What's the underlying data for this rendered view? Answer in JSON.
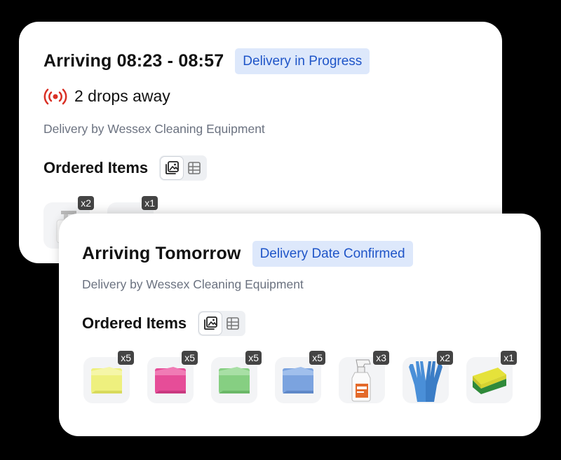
{
  "card1": {
    "title": "Arriving 08:23 - 08:57",
    "status_badge": "Delivery in Progress",
    "drops": "2 drops away",
    "vendor": "Delivery by Wessex Cleaning Equipment",
    "ordered_items_title": "Ordered Items",
    "items": [
      {
        "name": "soap-dispenser-icon",
        "qty": "x2"
      },
      {
        "name": "product-icon",
        "qty": "x1"
      }
    ]
  },
  "card2": {
    "title": "Arriving Tomorrow",
    "status_badge": "Delivery Date Confirmed",
    "vendor": "Delivery by Wessex Cleaning Equipment",
    "ordered_items_title": "Ordered Items",
    "items": [
      {
        "name": "yellow-cloth-icon",
        "qty": "x5",
        "color": "#f0f08a"
      },
      {
        "name": "pink-cloth-icon",
        "qty": "x5",
        "color": "#e8559f"
      },
      {
        "name": "green-cloth-icon",
        "qty": "x5",
        "color": "#8fd28a"
      },
      {
        "name": "blue-cloth-icon",
        "qty": "x5",
        "color": "#7fa7e0"
      },
      {
        "name": "spray-bottle-icon",
        "qty": "x3"
      },
      {
        "name": "gloves-icon",
        "qty": "x2"
      },
      {
        "name": "sponge-icon",
        "qty": "x1"
      }
    ]
  },
  "colors": {
    "badge_bg": "#dde8fb",
    "badge_text": "#1f55c8",
    "signal_red": "#d93025"
  }
}
